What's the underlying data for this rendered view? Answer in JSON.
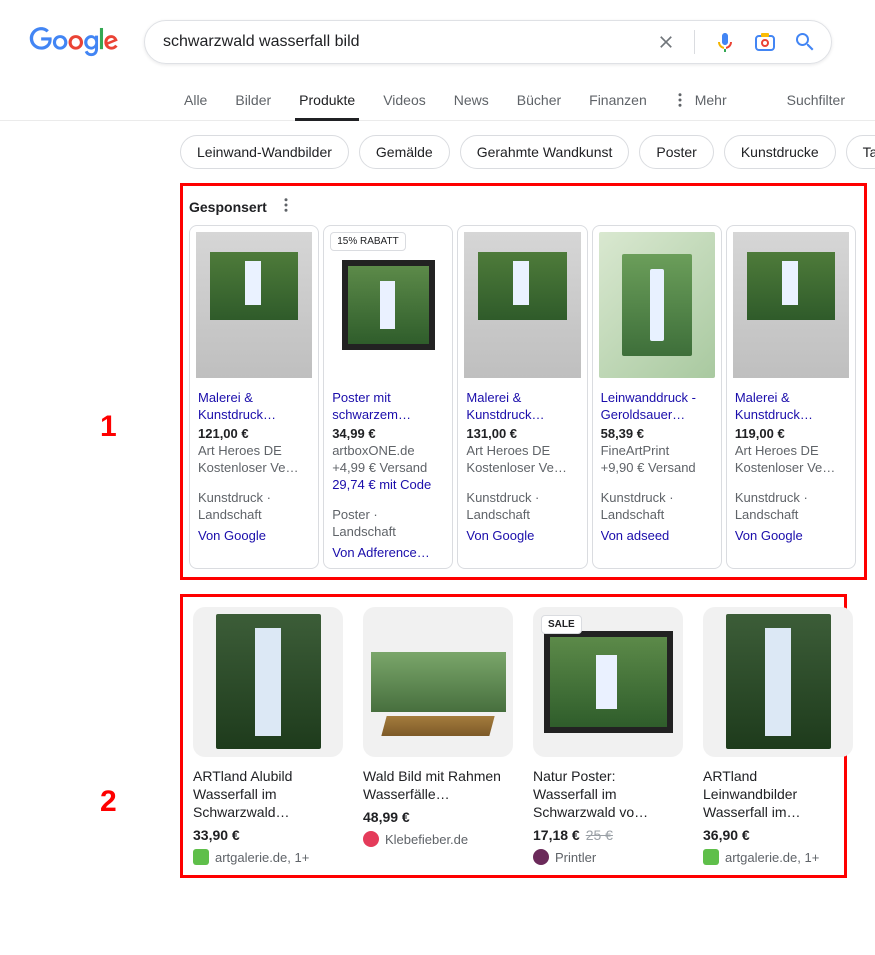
{
  "search": {
    "query": "schwarzwald wasserfall bild"
  },
  "tabs": {
    "items": [
      "Alle",
      "Bilder",
      "Produkte",
      "Videos",
      "News",
      "Bücher",
      "Finanzen"
    ],
    "mehr": "Mehr",
    "suchfilter": "Suchfilter",
    "activeIndex": 2
  },
  "chips": [
    "Leinwand-Wandbilder",
    "Gemälde",
    "Gerahmte Wandkunst",
    "Poster",
    "Kunstdrucke",
    "Tap"
  ],
  "sponsored": {
    "label": "Gesponsert",
    "items": [
      {
        "badge": "",
        "title": "Malerei & Kunstdruck…",
        "price": "121,00 €",
        "seller": "Art Heroes DE",
        "shipping": "Kostenloser Ve…",
        "promo": "",
        "type1": "Kunstdruck ·",
        "type2": "Landschaft",
        "by": "Von Google"
      },
      {
        "badge": "15% RABATT",
        "title": "Poster mit schwarzem…",
        "price": "34,99 €",
        "seller": "artboxONE.de",
        "shipping": "+4,99 € Versand",
        "promo": "29,74 € mit Code",
        "type1": "Poster ·",
        "type2": "Landschaft",
        "by": "Von Adference…"
      },
      {
        "badge": "",
        "title": "Malerei & Kunstdruck…",
        "price": "131,00 €",
        "seller": "Art Heroes DE",
        "shipping": "Kostenloser Ve…",
        "promo": "",
        "type1": "Kunstdruck ·",
        "type2": "Landschaft",
        "by": "Von Google"
      },
      {
        "badge": "",
        "title": "Leinwanddruck - Geroldsauer…",
        "price": "58,39 €",
        "seller": "FineArtPrint",
        "shipping": "+9,90 € Versand",
        "promo": "",
        "type1": "Kunstdruck ·",
        "type2": "Landschaft",
        "by": "Von adseed"
      },
      {
        "badge": "",
        "title": "Malerei & Kunstdruck…",
        "price": "119,00 €",
        "seller": "Art Heroes DE",
        "shipping": "Kostenloser Ve…",
        "promo": "",
        "type1": "Kunstdruck ·",
        "type2": "Landschaft",
        "by": "Von Google"
      }
    ]
  },
  "organic": [
    {
      "title": "ARTland Alubild Wasserfall im Schwarzwald…",
      "price": "33,90 €",
      "strike": "",
      "seller": "artgalerie.de, 1+",
      "sale": ""
    },
    {
      "title": "Wald Bild mit Rahmen Wasserfälle…",
      "price": "48,99 €",
      "strike": "",
      "seller": "Klebefieber.de",
      "sale": ""
    },
    {
      "title": "Natur Poster: Wasserfall im Schwarzwald vo…",
      "price": "17,18 €",
      "strike": "25 €",
      "seller": "Printler",
      "sale": "SALE"
    },
    {
      "title": "ARTland Leinwandbilder Wasserfall im…",
      "price": "36,90 €",
      "strike": "",
      "seller": "artgalerie.de, 1+",
      "sale": ""
    }
  ],
  "markers": {
    "one": "1",
    "two": "2"
  }
}
